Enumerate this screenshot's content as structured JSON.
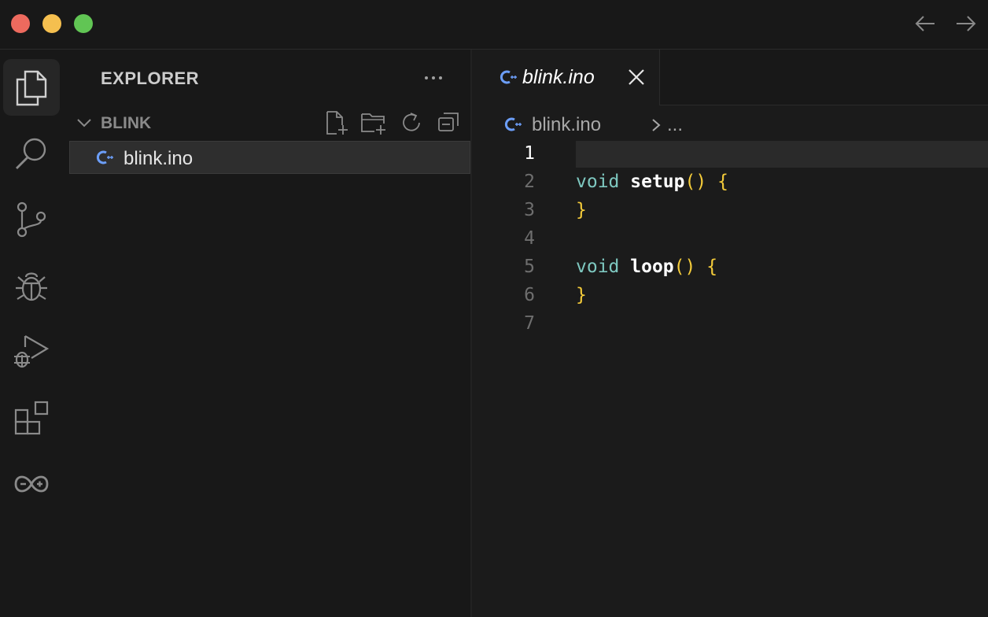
{
  "window": {
    "nav_back": "arrow-left-icon",
    "nav_forward": "arrow-right-icon"
  },
  "activity_bar": {
    "items": [
      {
        "name": "explorer",
        "icon": "files-icon",
        "active": true
      },
      {
        "name": "search",
        "icon": "search-icon",
        "active": false
      },
      {
        "name": "source-control",
        "icon": "source-control-icon",
        "active": false
      },
      {
        "name": "debug",
        "icon": "bug-icon",
        "active": false
      },
      {
        "name": "run-and-debug",
        "icon": "run-debug-icon",
        "active": false
      },
      {
        "name": "extensions",
        "icon": "extensions-icon",
        "active": false
      },
      {
        "name": "arduino",
        "icon": "arduino-icon",
        "active": false
      }
    ]
  },
  "sidebar": {
    "title": "EXPLORER",
    "more_icon": "ellipsis-icon",
    "folder": {
      "name": "BLINK",
      "expanded": true,
      "toolbar": [
        "new-file-icon",
        "new-folder-icon",
        "refresh-icon",
        "collapse-all-icon"
      ]
    },
    "files": [
      {
        "name": "blink.ino",
        "icon": "cpp-file-icon",
        "selected": true
      }
    ]
  },
  "editor": {
    "tab": {
      "label": "blink.ino",
      "icon": "cpp-file-icon",
      "close_icon": "close-icon"
    },
    "breadcrumb": {
      "file": "blink.ino",
      "separator_icon": "chevron-right-icon",
      "more": "..."
    },
    "current_line": 1,
    "lines": [
      {
        "number": "1",
        "tokens": []
      },
      {
        "number": "2",
        "tokens": [
          {
            "t": "void",
            "c": "kw"
          },
          {
            "t": " ",
            "c": ""
          },
          {
            "t": "setup",
            "c": "fn"
          },
          {
            "t": "()",
            "c": "pn"
          },
          {
            "t": " ",
            "c": ""
          },
          {
            "t": "{",
            "c": "pn"
          }
        ]
      },
      {
        "number": "3",
        "tokens": [
          {
            "t": "}",
            "c": "pn"
          }
        ]
      },
      {
        "number": "4",
        "tokens": []
      },
      {
        "number": "5",
        "tokens": [
          {
            "t": "void",
            "c": "kw"
          },
          {
            "t": " ",
            "c": ""
          },
          {
            "t": "loop",
            "c": "fn"
          },
          {
            "t": "()",
            "c": "pn"
          },
          {
            "t": " ",
            "c": ""
          },
          {
            "t": "{",
            "c": "pn"
          }
        ]
      },
      {
        "number": "6",
        "tokens": [
          {
            "t": "}",
            "c": "pn"
          }
        ]
      },
      {
        "number": "7",
        "tokens": []
      }
    ]
  },
  "colors": {
    "background": "#181818",
    "editor_background": "#1b1b1b",
    "keyword": "#7ec8c0",
    "bracket": "#f5cc3a",
    "file_icon": "#6c9ef8"
  }
}
